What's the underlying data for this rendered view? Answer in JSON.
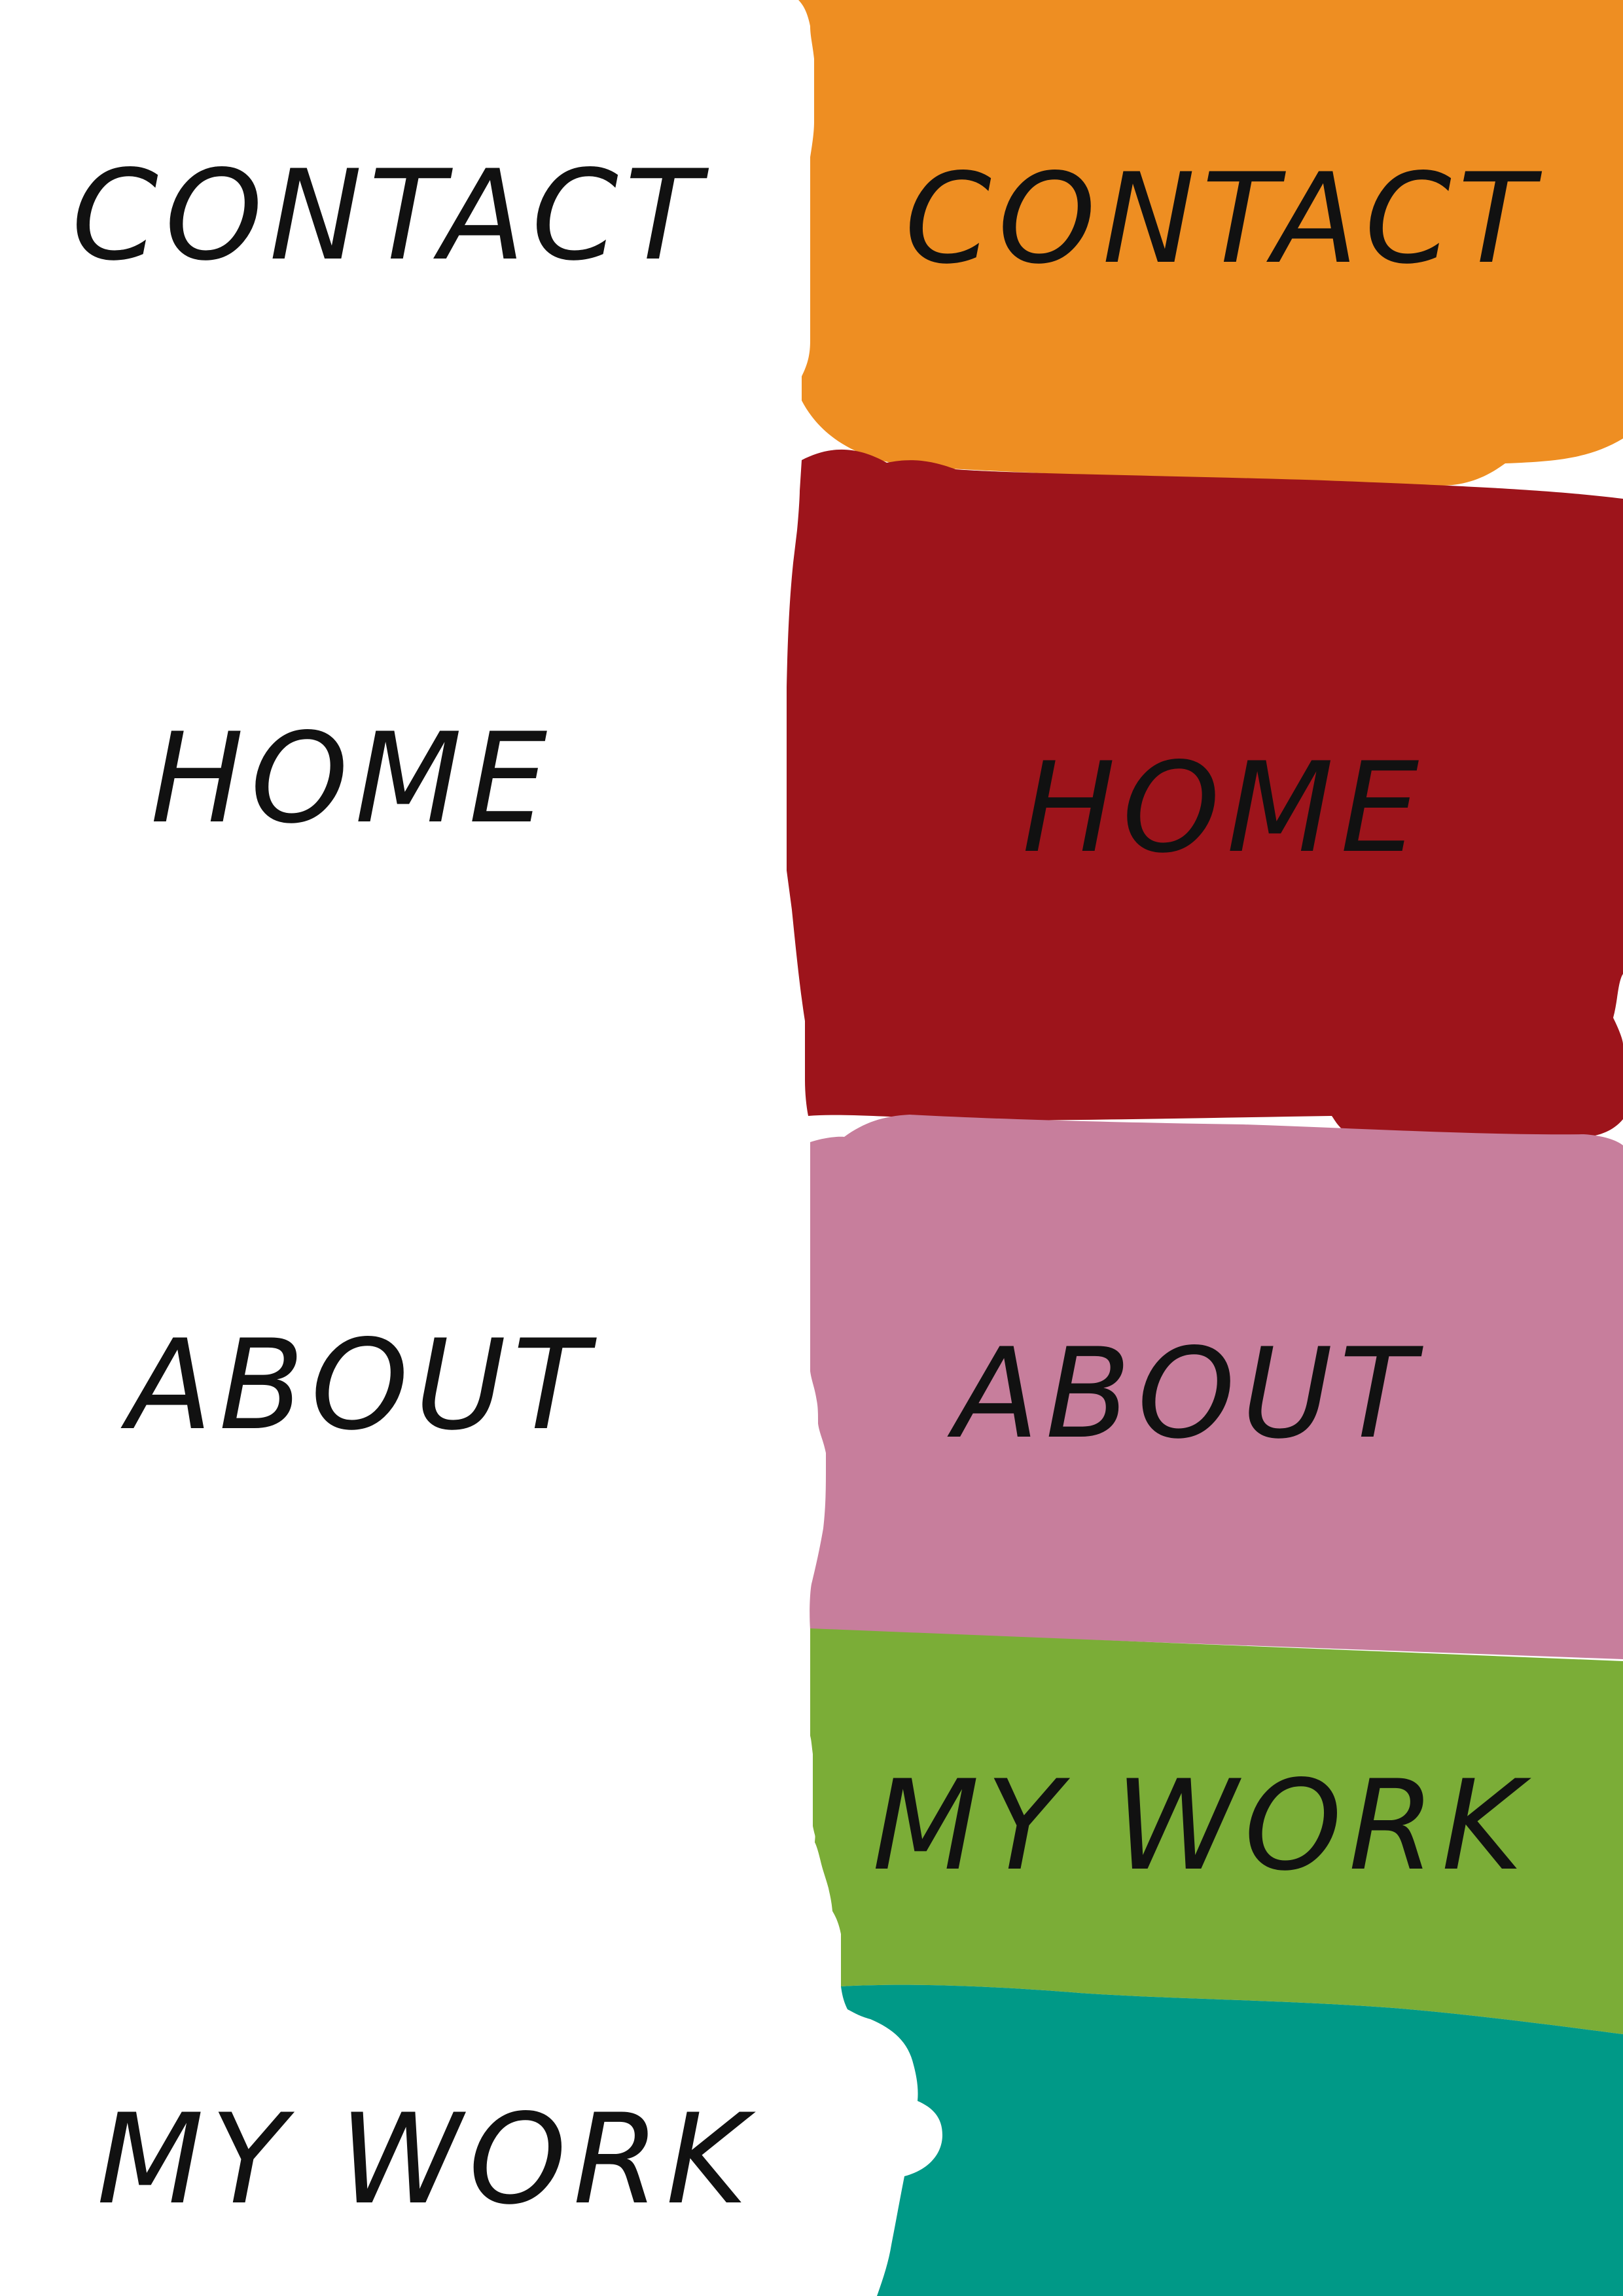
{
  "nav": {
    "labels": {
      "contact": "CONTACT",
      "home": "HOME",
      "about": "ABOUT",
      "my_work": "MY WORK"
    },
    "colors": {
      "contact": "#EE8E22",
      "home": "#9D141B",
      "about": "#C77E9C",
      "my_work": "#7BAD37",
      "teal": "#009987",
      "text": "#111111",
      "background": "#FFFFFF"
    }
  }
}
